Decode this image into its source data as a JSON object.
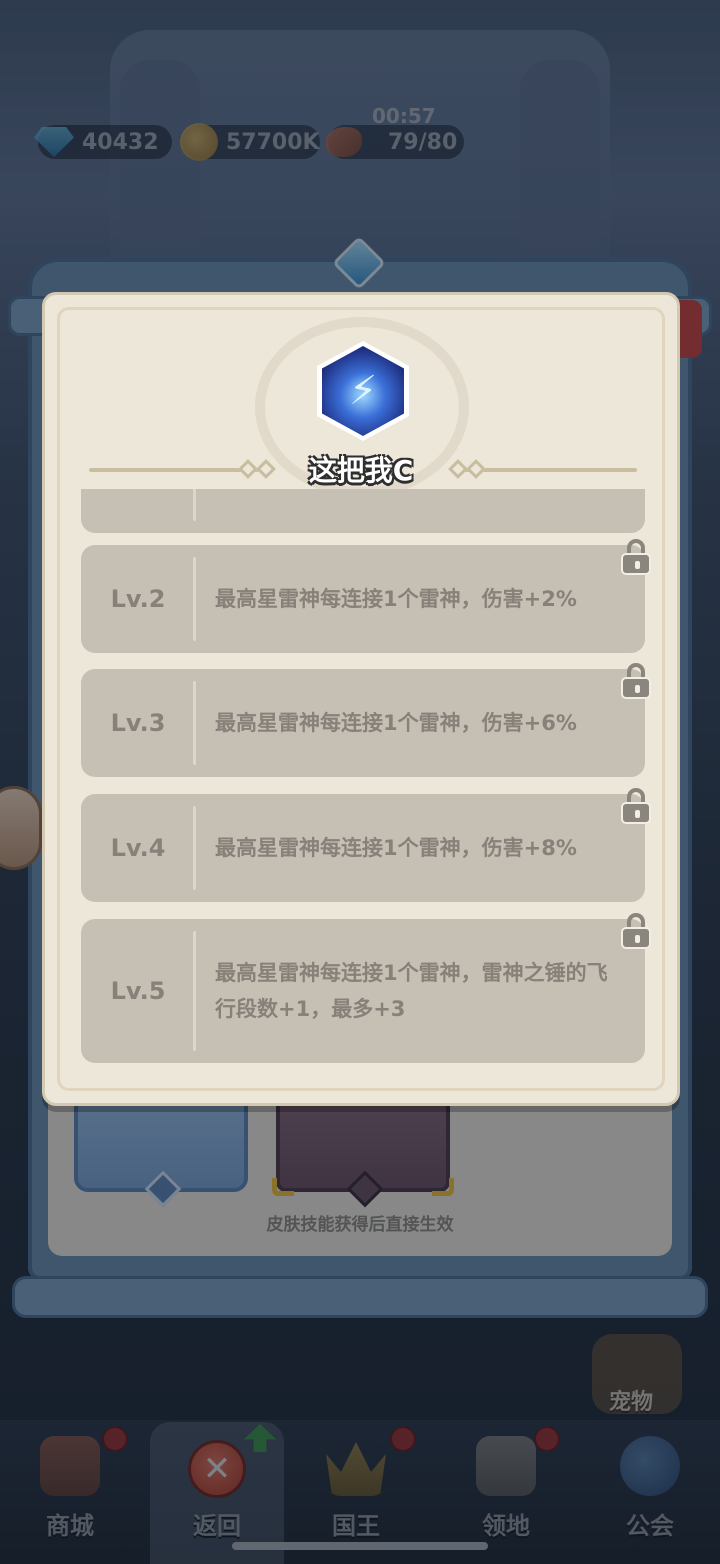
{
  "resources": {
    "gems": "40432",
    "gold": "57700K",
    "stamina": "79/80",
    "stamina_timer": "00:57"
  },
  "modal": {
    "title": "这把我C",
    "icon": "lightning-bolt-icon",
    "levels": [
      {
        "level": "Lv.2",
        "description": "最高星雷神每连接1个雷神，伤害+2%",
        "locked": true
      },
      {
        "level": "Lv.3",
        "description": "最高星雷神每连接1个雷神，伤害+6%",
        "locked": true
      },
      {
        "level": "Lv.4",
        "description": "最高星雷神每连接1个雷神，伤害+8%",
        "locked": true
      },
      {
        "level": "Lv.5",
        "description": "最高星雷神每连接1个雷神，雷神之锤的飞行段数+1，最多+3",
        "locked": true
      }
    ]
  },
  "skin_panel": {
    "note": "皮肤技能获得后直接生效"
  },
  "side": {
    "pet_label": "宠物"
  },
  "bottom_nav": {
    "items": [
      {
        "label": "商城",
        "icon": "shop-icon",
        "badge": true
      },
      {
        "label": "返回",
        "icon": "close-icon",
        "badge": false,
        "active": true
      },
      {
        "label": "国王",
        "icon": "crown-icon",
        "badge": true
      },
      {
        "label": "领地",
        "icon": "castle-icon",
        "badge": true
      },
      {
        "label": "公会",
        "icon": "planet-icon",
        "badge": false
      }
    ]
  },
  "colors": {
    "modal_bg": "#ede7d9",
    "row_bg": "#c6c0b4",
    "row_text": "#87817a",
    "frame_blue": "#6b8fb0"
  }
}
